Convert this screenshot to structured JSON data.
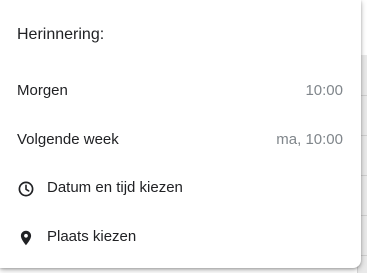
{
  "reminder_menu": {
    "title": "Herinnering:",
    "items": [
      {
        "label": "Morgen",
        "time": "10:00"
      },
      {
        "label": "Volgende week",
        "time": "ma, 10:00"
      },
      {
        "label": "Datum en tijd kiezen",
        "icon": "clock-icon"
      },
      {
        "label": "Plaats kiezen",
        "icon": "location-pin-icon"
      }
    ]
  },
  "colors": {
    "text_primary": "#202124",
    "text_secondary": "#80868b",
    "menu_background": "#ffffff"
  }
}
